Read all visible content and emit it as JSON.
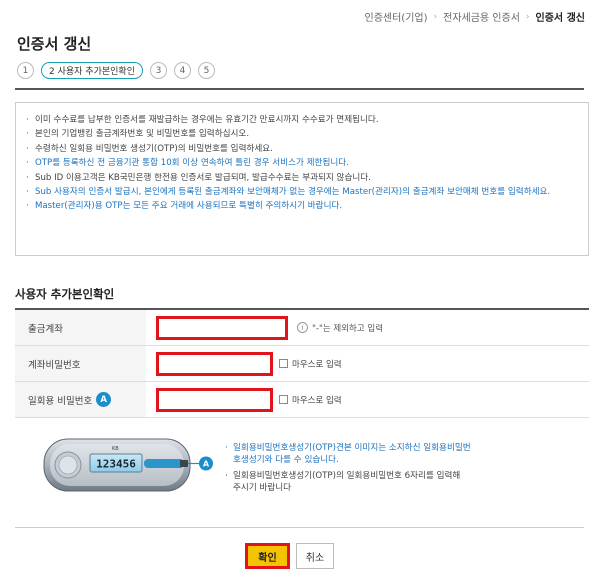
{
  "breadcrumb": {
    "items": [
      "인증센터(기업)",
      "전자세금용 인증서",
      "인증서 갱신"
    ]
  },
  "page": {
    "title": "인증서 갱신"
  },
  "steps": {
    "items": [
      "1",
      "2 사용자 추가본인확인",
      "3",
      "4",
      "5"
    ],
    "active_index": 1
  },
  "notice": {
    "items": [
      "이미 수수료를 납부한 인증서를 재발급하는 경우에는 유효기간 만료시까지 수수료가 면제됩니다.",
      "본인의 기업뱅킹 출금계좌번호 및 비밀번호를 입력하십시오.",
      "수령하신 일회용 비밀번호 생성기(OTP)의 비밀번호를 입력하세요.",
      "OTP를 등록하신 전 금융기관 통합 10회 이상 연속하여 틀린 경우 서비스가 제한됩니다.",
      "Sub ID 이용고객은 KB국민은행 한전용 인증서로 발급되며, 발급수수료는 부과되지 않습니다.",
      "Sub 사용자의 인증서 발급시, 본인에게 등록된 출금계좌와 보안매체가 없는 경우에는 Master(관리자)의 출금계좌 보안매체 번호를 입력하세요.",
      "Master(관리자)용 OTP는 모든 주요 거래에 사용되므로 특별히 주의하시기 바랍니다."
    ]
  },
  "form": {
    "title": "사용자 추가본인확인",
    "account_label": "출금계좌",
    "account_value": "",
    "account_hint": "\"-\"는 제외하고 입력",
    "account_hint_icon": "info-icon",
    "password_label": "계좌비밀번호",
    "password_value": "",
    "otp_label": "일회용 비밀번호",
    "otp_badge": "A",
    "otp_value": "",
    "mouse_input_label": "마우스로 입력"
  },
  "otp_guide": {
    "device_brand": "KB",
    "device_number": "123456",
    "device_badge": "A",
    "notes": [
      "일회용비밀번호생성기(OTP)견본 이미지는 소지하신 일회용비밀번호생성기와 다를 수 있습니다.",
      "일회용비밀번호생성기(OTP)의 일회용비밀번호 6자리를 입력해 주시기 바랍니다"
    ]
  },
  "actions": {
    "confirm_label": "확인",
    "cancel_label": "취소"
  },
  "colors": {
    "highlight_border": "#e0141b",
    "confirm_bg": "#f5c400",
    "link_blue": "#1b73c0",
    "step_active_border": "#1a9fb0",
    "badge_blue": "#1b8ec9"
  }
}
